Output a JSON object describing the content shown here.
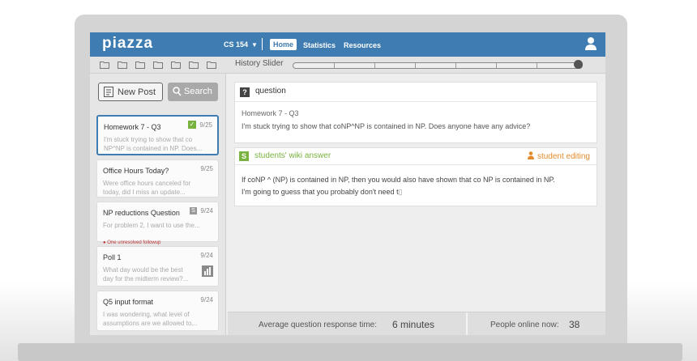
{
  "app": {
    "logo": "piazza",
    "brand_color": "#3e7cb1"
  },
  "header": {
    "course": "CS 154",
    "nav": [
      "Home",
      "Statistics",
      "Resources"
    ],
    "active_nav": "Home"
  },
  "toolbar": {
    "history_label": "History Slider",
    "folder_count": 7
  },
  "sidebar": {
    "new_post_label": "New Post",
    "search_label": "Search",
    "posts": [
      {
        "title": "Homework 7 - Q3",
        "date": "9/25",
        "snippet_1": "I'm stuck trying to show that co",
        "snippet_2": "NP^NP is contained in NP.  Does..."
      },
      {
        "title": "Office Hours Today?",
        "date": "9/25",
        "snippet_1": "Were office hours canceled for",
        "snippet_2": "today, did I miss an update..."
      },
      {
        "title": "NP reductions Question",
        "date": "9/24",
        "badge": "S",
        "snippet_1": "For problem 2, I want to use the...",
        "followup": "One unresolved followup"
      },
      {
        "title": "Poll 1",
        "date": "9/24",
        "snippet_1": "What day would be the best",
        "snippet_2": "day for the midterm review?..."
      },
      {
        "title": "Q5 input format",
        "date": "9/24",
        "snippet_1": "I was wondering, what level of",
        "snippet_2": "assumptions are we allowed to..."
      }
    ]
  },
  "question": {
    "badge": "?",
    "label": "question",
    "subject": "Homework 7 - Q3",
    "body": "I'm stuck trying to show that coNP^NP is contained in NP.  Does anyone have any advice?"
  },
  "answer": {
    "badge": "S",
    "label": "students' wiki answer",
    "editing": "student editing",
    "body_1": "If coNP ^ (NP) is contained in NP, then you would also have shown that co NP is contained in NP.",
    "body_2": "I'm going to guess that you probably don't need t"
  },
  "stats": {
    "response_label": "Average question response time:",
    "response_value": "6 minutes",
    "online_label": "People online now:",
    "online_value": "38"
  }
}
